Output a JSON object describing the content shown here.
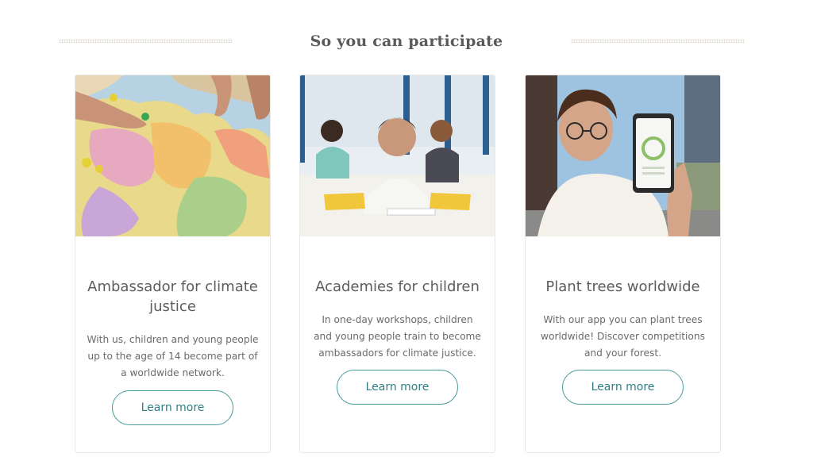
{
  "section": {
    "title": "So you can participate"
  },
  "cards": [
    {
      "title": "Ambassador for climate justice",
      "text": "With us, children and young people up to the age of 14 become part of a worldwide network.",
      "button": "Learn more"
    },
    {
      "title": "Academies for children",
      "text": "In one-day workshops, children and young people train to become ambassadors for climate justice.",
      "button": "Learn more"
    },
    {
      "title": "Plant trees worldwide",
      "text": "With our app you can plant trees worldwide! Discover competitions and your forest.",
      "button": "Learn more"
    }
  ],
  "colors": {
    "accent": "#4a9a9a",
    "button_text": "#2f7f86",
    "title_text": "#5d5d5d"
  }
}
